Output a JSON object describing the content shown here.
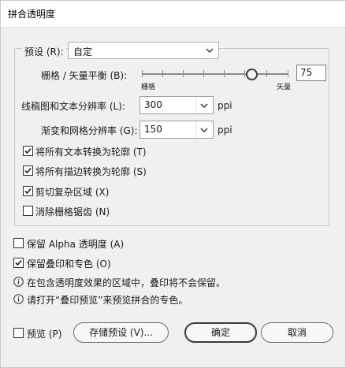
{
  "window": {
    "title": "拼合透明度"
  },
  "preset": {
    "label": "预设 (R):",
    "value": "自定"
  },
  "balance": {
    "label": "栅格 / 矢量平衡 (B):",
    "value": "75",
    "left_label": "栅格",
    "right_label": "矢量",
    "level_percent": 75
  },
  "line_art": {
    "label": "线稿图和文本分辨率 (L):",
    "value": "300",
    "unit": "ppi"
  },
  "gradient": {
    "label": "渐变和网格分辨率 (G):",
    "value": "150",
    "unit": "ppi"
  },
  "options": [
    {
      "label": "将所有文本转换为轮廓 (T)",
      "checked": true
    },
    {
      "label": "将所有描边转换为轮廓 (S)",
      "checked": true
    },
    {
      "label": "剪切复杂区域 (X)",
      "checked": true
    },
    {
      "label": "消除栅格锯齿 (N)",
      "checked": false
    }
  ],
  "preserve_alpha": {
    "label": "保留 Alpha 透明度 (A)",
    "checked": false
  },
  "preserve_overprint": {
    "label": "保留叠印和专色 (O)",
    "checked": true
  },
  "info": [
    "在包含透明度效果的区域中，叠印将不会保留。",
    "请打开“叠印预览”来预览拼合的专色。"
  ],
  "footer": {
    "preview_label": "预览 (P)",
    "save_preset_label": "存储预设 (V)...",
    "ok_label": "确定",
    "cancel_label": "取消"
  }
}
